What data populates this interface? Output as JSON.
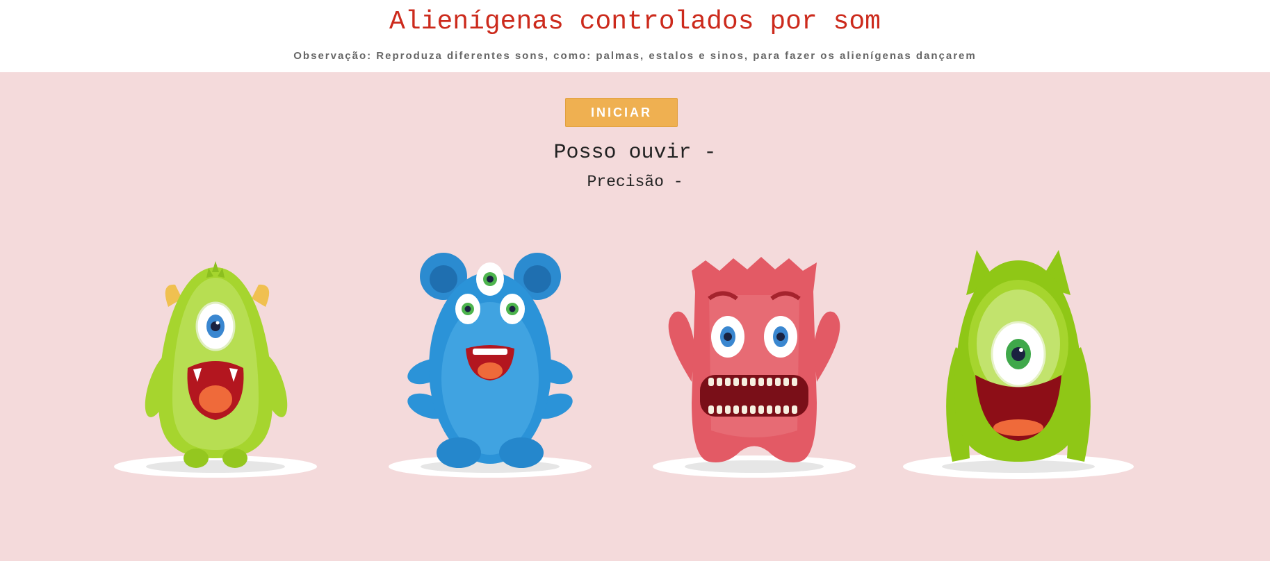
{
  "header": {
    "title": "Alienígenas controlados por som",
    "note": "Observação: Reproduza diferentes sons, como: palmas, estalos e sinos, para fazer os alienígenas dançarem"
  },
  "controls": {
    "start_label": "INICIAR",
    "hear_label": "Posso ouvir -",
    "precision_label": "Precisão -"
  },
  "colors": {
    "background": "#f4dadb",
    "title": "#cc2a1c",
    "button": "#efb051"
  },
  "aliens": [
    {
      "icon": "green-one-eyed-horned-alien-icon",
      "color": "#a6d52e"
    },
    {
      "icon": "blue-three-eyed-alien-icon",
      "color": "#2b93d8"
    },
    {
      "icon": "red-two-eyed-alien-icon",
      "color": "#e35a65"
    },
    {
      "icon": "green-cyclops-alien-icon",
      "color": "#8fc716"
    }
  ]
}
